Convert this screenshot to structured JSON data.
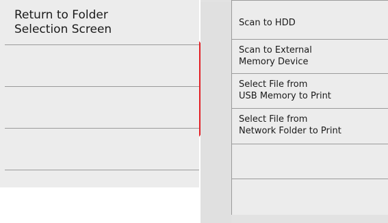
{
  "left_panel": {
    "rows": [
      {
        "label": "Return to Folder\nSelection Screen"
      },
      {
        "label": ""
      },
      {
        "label": ""
      },
      {
        "label": ""
      },
      {
        "label": ""
      }
    ]
  },
  "arrow": {
    "color": "#e31e24",
    "icon": "right-arrow-icon"
  },
  "right_panel": {
    "rows": [
      {
        "label": "Scan to HDD"
      },
      {
        "label": "Scan to External\nMemory Device"
      },
      {
        "label": "Select File from\nUSB Memory to Print"
      },
      {
        "label": "Select File from\nNetwork Folder to Print"
      },
      {
        "label": ""
      },
      {
        "label": ""
      }
    ]
  }
}
